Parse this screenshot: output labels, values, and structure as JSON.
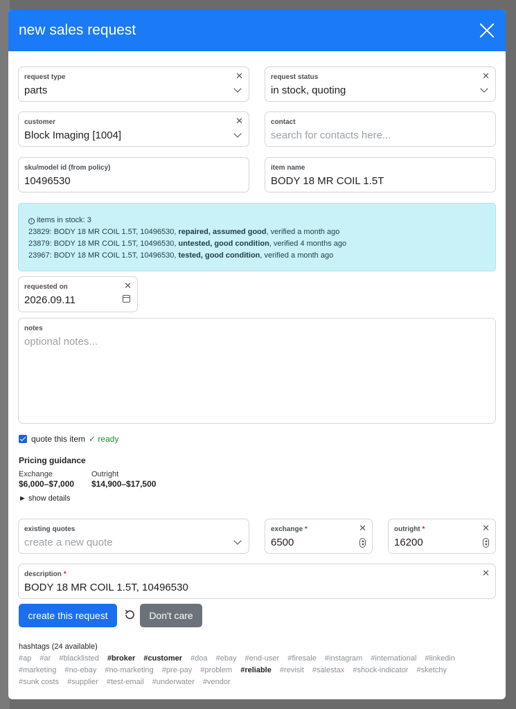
{
  "modal": {
    "title": "new sales request"
  },
  "fields": {
    "request_type": {
      "label": "request type",
      "value": "parts"
    },
    "request_status": {
      "label": "request status",
      "value": "in stock, quoting"
    },
    "customer": {
      "label": "customer",
      "value": "Block Imaging [1004]"
    },
    "contact": {
      "label": "contact",
      "placeholder": "search for contacts here..."
    },
    "sku": {
      "label": "sku/model id (from policy)",
      "value": "10496530"
    },
    "item_name": {
      "label": "item name",
      "value": "BODY 18 MR COIL 1.5T"
    },
    "requested_on": {
      "label": "requested on",
      "value": "2026.09.11"
    },
    "notes": {
      "label": "notes",
      "placeholder": "optional notes..."
    },
    "existing_quotes": {
      "label": "existing quotes",
      "placeholder": "create a new quote"
    },
    "exchange": {
      "label": "exchange",
      "required_mark": "*",
      "value": "6500"
    },
    "outright": {
      "label": "outright",
      "required_mark": "*",
      "value": "16200"
    },
    "description": {
      "label": "description",
      "required_mark": "*",
      "value": "BODY 18 MR COIL 1.5T, 10496530"
    }
  },
  "stock": {
    "header": "items in stock: 3",
    "items": [
      {
        "prefix": "23829: BODY 18 MR COIL 1.5T, 10496530, ",
        "status": "repaired, assumed good",
        "suffix": ", verified a month ago"
      },
      {
        "prefix": "23879: BODY 18 MR COIL 1.5T, 10496530, ",
        "status": "untested, good condition",
        "suffix": ", verified 4 months ago"
      },
      {
        "prefix": "23967: BODY 18 MR COIL 1.5T, 10496530, ",
        "status": "tested, good condition",
        "suffix": ", verified a month ago"
      }
    ]
  },
  "quote": {
    "label": "quote this item",
    "ready": "✓ ready"
  },
  "pricing": {
    "title": "Pricing guidance",
    "exchange_label": "Exchange",
    "exchange_value": "$6,000–$7,000",
    "outright_label": "Outright",
    "outright_value": "$14,900–$17,500",
    "details": "► show details"
  },
  "buttons": {
    "create": "create this request",
    "dont_care": "Don't care"
  },
  "hashtags": {
    "heading": "hashtags (24 available)",
    "tags": [
      {
        "text": "#ap",
        "bold": false
      },
      {
        "text": "#ar",
        "bold": false
      },
      {
        "text": "#blacklisted",
        "bold": false
      },
      {
        "text": "#broker",
        "bold": true
      },
      {
        "text": "#customer",
        "bold": true
      },
      {
        "text": "#doa",
        "bold": false
      },
      {
        "text": "#ebay",
        "bold": false
      },
      {
        "text": "#end-user",
        "bold": false
      },
      {
        "text": "#firesale",
        "bold": false
      },
      {
        "text": "#instagram",
        "bold": false
      },
      {
        "text": "#international",
        "bold": false
      },
      {
        "text": "#linkedin",
        "bold": false
      },
      {
        "text": "#marketing",
        "bold": false
      },
      {
        "text": "#no-ebay",
        "bold": false
      },
      {
        "text": "#no-marketing",
        "bold": false
      },
      {
        "text": "#pre-pay",
        "bold": false
      },
      {
        "text": "#problem",
        "bold": false
      },
      {
        "text": "#reliable",
        "bold": true
      },
      {
        "text": "#revisit",
        "bold": false
      },
      {
        "text": "#salestax",
        "bold": false
      },
      {
        "text": "#shock-indicator",
        "bold": false
      },
      {
        "text": "#sketchy",
        "bold": false
      },
      {
        "text": "#sunk costs",
        "bold": false
      },
      {
        "text": "#supplier",
        "bold": false
      },
      {
        "text": "#test-email",
        "bold": false
      },
      {
        "text": "#underwater",
        "bold": false
      },
      {
        "text": "#vendor",
        "bold": false
      }
    ]
  },
  "colors": {
    "primary": "#1a7af8",
    "secondary": "#6b7279",
    "info_bg": "#c9f2f8",
    "ready": "#1f8a3a"
  }
}
